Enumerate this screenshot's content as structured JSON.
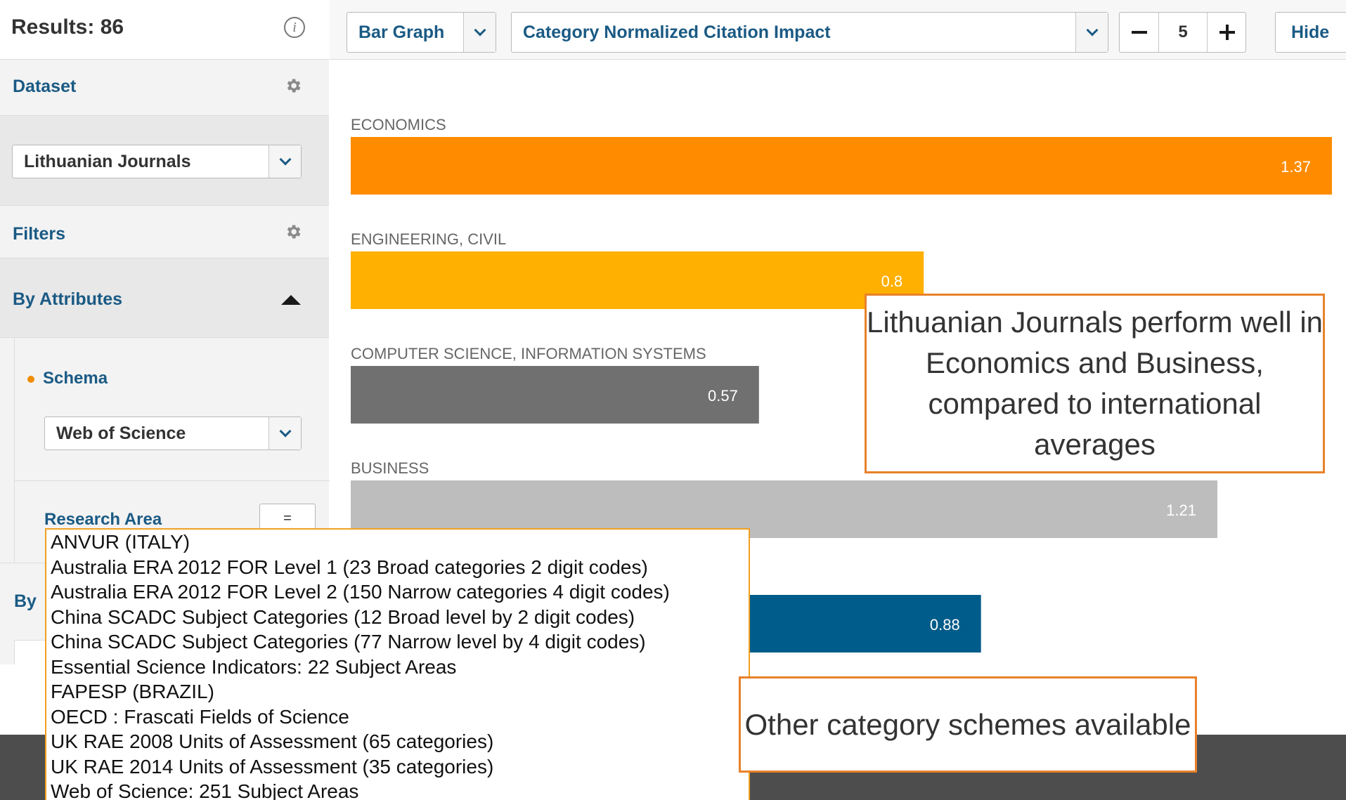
{
  "sidebar": {
    "results_label": "Results: 86",
    "dataset": {
      "title": "Dataset",
      "selected": "Lithuanian Journals"
    },
    "filters": {
      "title": "Filters"
    },
    "by_attributes": {
      "title": "By Attributes",
      "schema_label": "Schema",
      "schema_selected": "Web of Science",
      "research_area_label": "Research Area",
      "research_area_button": "="
    },
    "by_partial_label": "By"
  },
  "toolbar": {
    "chart_type": "Bar Graph",
    "indicator": "Category Normalized Citation Impact",
    "count": "5",
    "hide_label": "Hide"
  },
  "chart_data": {
    "type": "bar",
    "orientation": "horizontal",
    "categories": [
      "ECONOMICS",
      "ENGINEERING, CIVIL",
      "COMPUTER SCIENCE, INFORMATION SYSTEMS",
      "BUSINESS",
      ""
    ],
    "values": [
      1.37,
      0.8,
      0.57,
      1.21,
      0.88
    ],
    "value_labels": [
      "1.37",
      "0.8",
      "0.57",
      "1.21",
      "0.88"
    ],
    "colors": [
      "#ff8c00",
      "#ffb000",
      "#707070",
      "#bdbdbd",
      "#005c8a"
    ],
    "xlim": [
      0,
      1.37
    ],
    "grid": false
  },
  "dropdown": {
    "options": [
      "ANVUR (ITALY)",
      "Australia ERA 2012 FOR Level 1 (23 Broad categories 2 digit codes)",
      "Australia ERA 2012 FOR Level 2 (150 Narrow categories 4 digit codes)",
      "China SCADC Subject Categories (12 Broad level by 2 digit codes)",
      "China SCADC Subject Categories (77 Narrow level by 4 digit codes)",
      "Essential Science Indicators: 22 Subject Areas",
      "FAPESP (BRAZIL)",
      "OECD : Frascati Fields of Science",
      "UK RAE 2008 Units of Assessment (65 categories)",
      "UK RAE 2014 Units of Assessment (35 categories)",
      "Web of Science: 251 Subject Areas"
    ]
  },
  "callouts": {
    "performance_note": "Lithuanian Journals perform well in Economics and Business, compared to international averages",
    "schemes_note": "Other category schemes available"
  },
  "colors": {
    "accent_blue": "#1a5a84",
    "callout_border": "#e8812a",
    "dropdown_border": "#f0a020"
  },
  "icons": {
    "info": "info-icon",
    "gear": "gear-icon",
    "collapse": "triangle-up-icon",
    "dropdown": "chevron-down-icon",
    "minus": "minus-icon",
    "plus": "plus-icon"
  }
}
